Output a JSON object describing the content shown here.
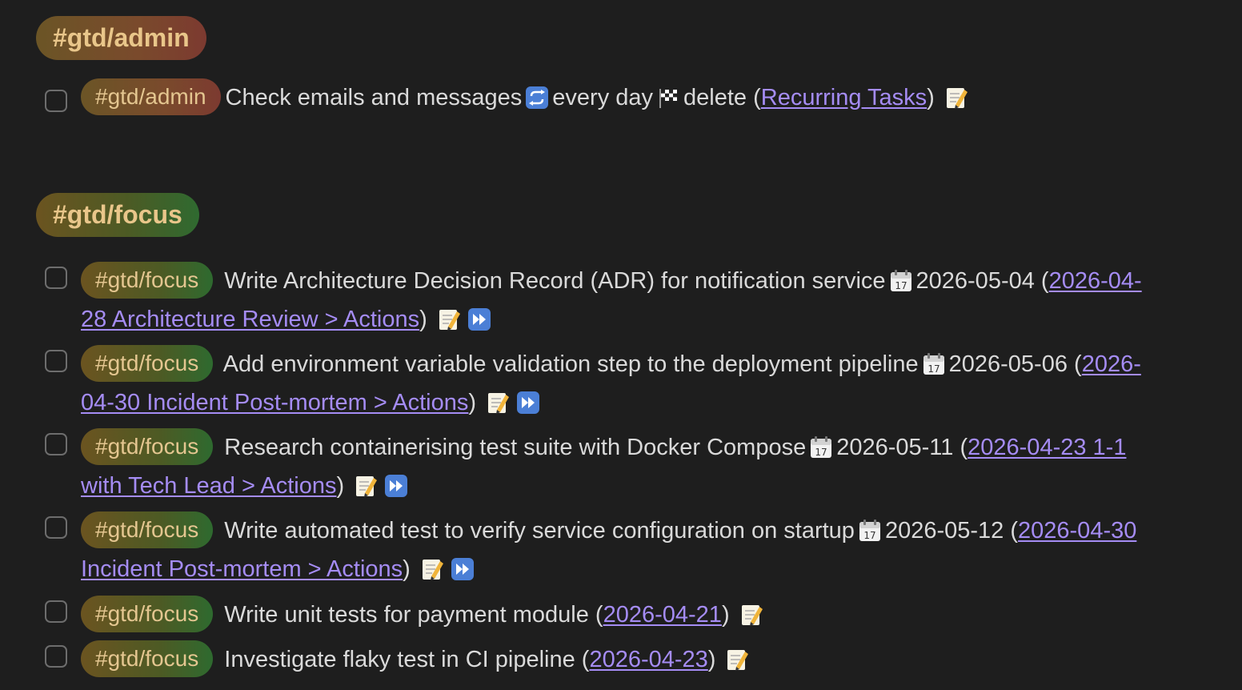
{
  "sections": [
    {
      "heading": "#gtd/admin",
      "tasks": [
        {
          "tag": "#gtd/admin",
          "text": "Check emails and messages",
          "recurrence": "every day",
          "done_action": "delete",
          "link": "Recurring Tasks"
        }
      ]
    },
    {
      "heading": "#gtd/focus",
      "tasks": [
        {
          "tag": "#gtd/focus",
          "text": "Write Architecture Decision Record (ADR) for notification service",
          "due": "2026-05-04",
          "link": "2026-04-28 Architecture Review > Actions"
        },
        {
          "tag": "#gtd/focus",
          "text": "Add environment variable validation step to the deployment pipeline",
          "due": "2026-05-06",
          "link": "2026-04-30 Incident Post-mortem > Actions"
        },
        {
          "tag": "#gtd/focus",
          "text": "Research containerising test suite with Docker Compose",
          "due": "2026-05-11",
          "link": "2026-04-23 1-1 with Tech Lead > Actions"
        },
        {
          "tag": "#gtd/focus",
          "text": "Write automated test to verify service configuration on startup",
          "due": "2026-05-12",
          "link": "2026-04-30 Incident Post-mortem > Actions"
        },
        {
          "tag": "#gtd/focus",
          "text": "Write unit tests for payment module",
          "link": "2026-04-21"
        },
        {
          "tag": "#gtd/focus",
          "text": "Investigate flaky test in CI pipeline",
          "link": "2026-04-23"
        }
      ]
    }
  ],
  "icons": {
    "recurrence": "repeat-icon",
    "on_completion": "checkered-flag-icon",
    "due": "calendar-icon",
    "edit": "memo-pencil-icon",
    "postpone": "fast-forward-icon"
  },
  "colors": {
    "background": "#1e1e1e",
    "text": "#dadada",
    "link": "#a58cf4",
    "tag_text": "#e4c690"
  }
}
